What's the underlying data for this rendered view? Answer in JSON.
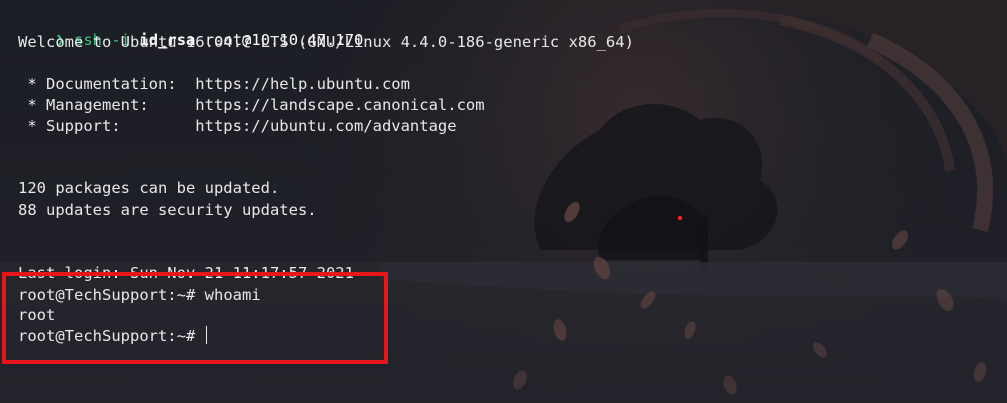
{
  "terminal": {
    "prompt_symbol": "❯",
    "ssh_command": {
      "cmd": "ssh",
      "flag": "-i",
      "keyfile": "id_rsa",
      "target": "root@10.10.47.170"
    },
    "welcome": "Welcome to Ubuntu 16.04.7 LTS (GNU/Linux 4.4.0-186-generic x86_64)",
    "motd_links": [
      " * Documentation:  https://help.ubuntu.com",
      " * Management:     https://landscape.canonical.com",
      " * Support:        https://ubuntu.com/advantage"
    ],
    "packages_line": "120 packages can be updated.",
    "security_line": "88 updates are security updates.",
    "last_login": "Last login: Sun Nov 21 11:17:57 2021",
    "session": {
      "prompt": "root@TechSupport:~#",
      "command": "whoami",
      "output": "root",
      "prompt_again": "root@TechSupport:~#"
    }
  },
  "colors": {
    "highlight_box": "#e8151b",
    "command_green": "#3ec07c",
    "background": "#1f2027"
  },
  "icons": {
    "prompt": "chevron-right-icon"
  }
}
